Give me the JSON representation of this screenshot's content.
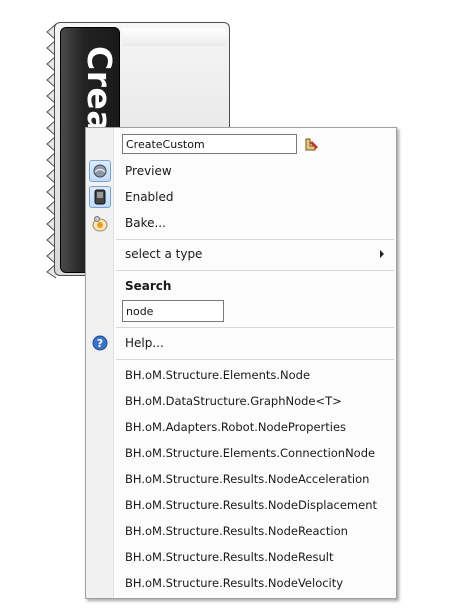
{
  "component": {
    "name": "CreateCustom"
  },
  "menu": {
    "name_value": "CreateCustom",
    "items": {
      "preview": "Preview",
      "enabled": "Enabled",
      "bake": "Bake..."
    },
    "select_type": "select a type",
    "search_heading": "Search",
    "search_value": "node",
    "help": "Help...",
    "results": [
      "BH.oM.Structure.Elements.Node",
      "BH.oM.DataStructure.GraphNode<T>",
      "BH.oM.Adapters.Robot.NodeProperties",
      "BH.oM.Structure.Elements.ConnectionNode",
      "BH.oM.Structure.Results.NodeAcceleration",
      "BH.oM.Structure.Results.NodeDisplacement",
      "BH.oM.Structure.Results.NodeReaction",
      "BH.oM.Structure.Results.NodeResult",
      "BH.oM.Structure.Results.NodeVelocity"
    ]
  },
  "colors": {
    "menu_bg": "#fcfcfc",
    "checked_bg": "#c1dbfc",
    "checked_border": "#7da2ce",
    "help_icon": "#3b74c4"
  }
}
